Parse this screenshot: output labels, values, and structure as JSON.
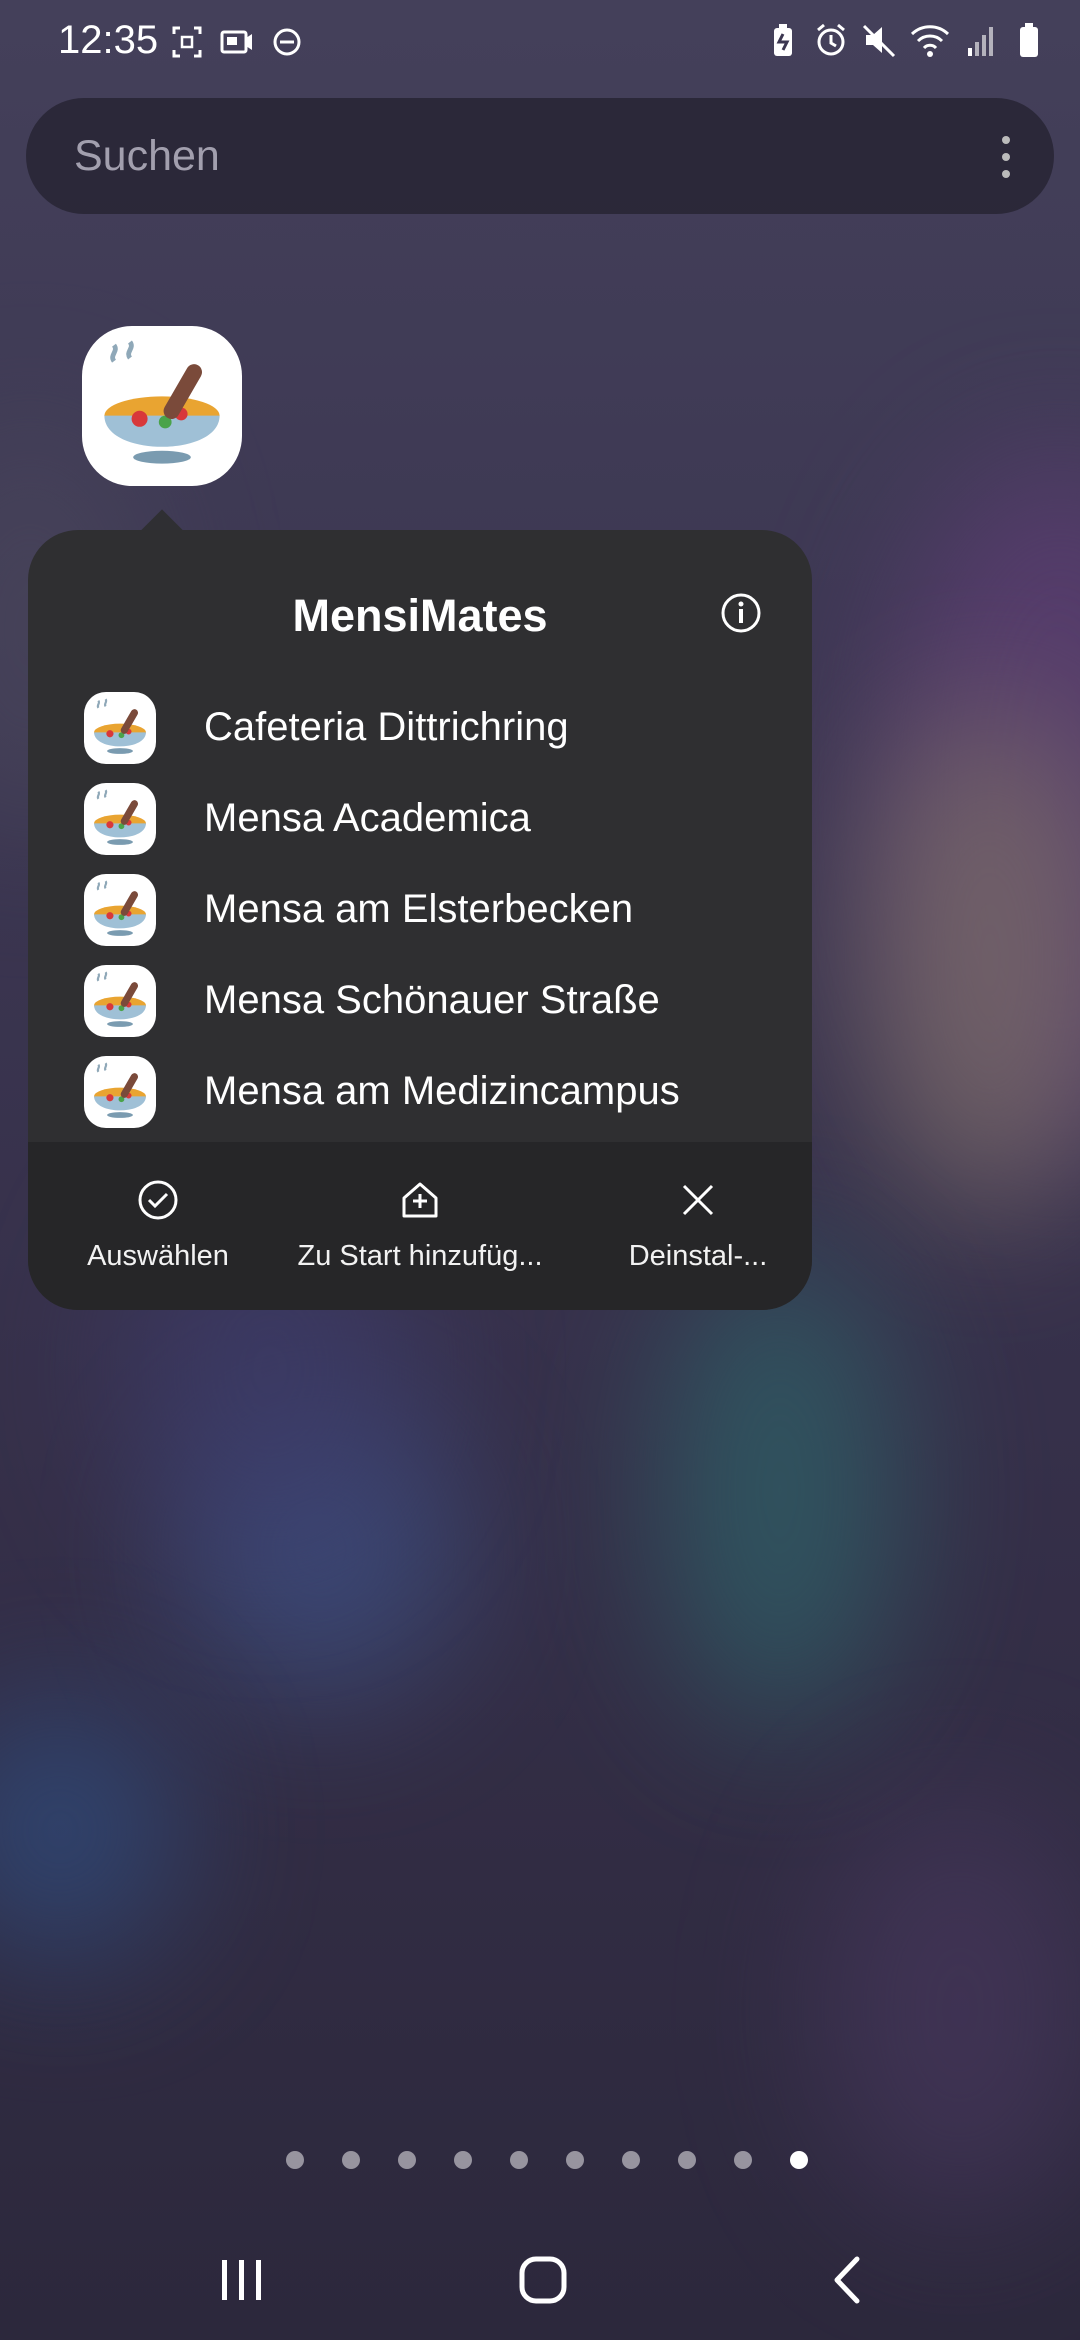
{
  "status_bar": {
    "time": "12:35",
    "left_icons": [
      "screenshot-icon",
      "video-message-icon",
      "do-not-disturb-icon"
    ],
    "right_icons": [
      "battery-saver-icon",
      "alarm-icon",
      "mute-icon",
      "wifi-icon",
      "signal-icon",
      "battery-icon"
    ]
  },
  "search": {
    "placeholder": "Suchen",
    "menu_icon": "more-vert-icon"
  },
  "app": {
    "name": "MensiMates",
    "icon": "soup-bowl-icon"
  },
  "popup": {
    "title": "MensiMates",
    "info_icon": "info-icon",
    "shortcuts": [
      {
        "label": "Cafeteria Dittrichring",
        "icon": "soup-bowl-icon"
      },
      {
        "label": "Mensa Academica",
        "icon": "soup-bowl-icon"
      },
      {
        "label": "Mensa am Elsterbecken",
        "icon": "soup-bowl-icon"
      },
      {
        "label": "Mensa Schönauer Straße",
        "icon": "soup-bowl-icon"
      },
      {
        "label": "Mensa am Medizincampus",
        "icon": "soup-bowl-icon"
      }
    ],
    "actions": [
      {
        "label": "Auswählen",
        "icon": "check-circle-icon"
      },
      {
        "label": "Zu Start hinzufüg...",
        "icon": "add-home-icon"
      },
      {
        "label": "Deinstal-...",
        "icon": "close-icon"
      }
    ]
  },
  "page_indicator": {
    "count": 10,
    "active_index": 9
  },
  "nav_bar": {
    "buttons": [
      "recent-apps-icon",
      "home-icon",
      "back-icon"
    ]
  }
}
